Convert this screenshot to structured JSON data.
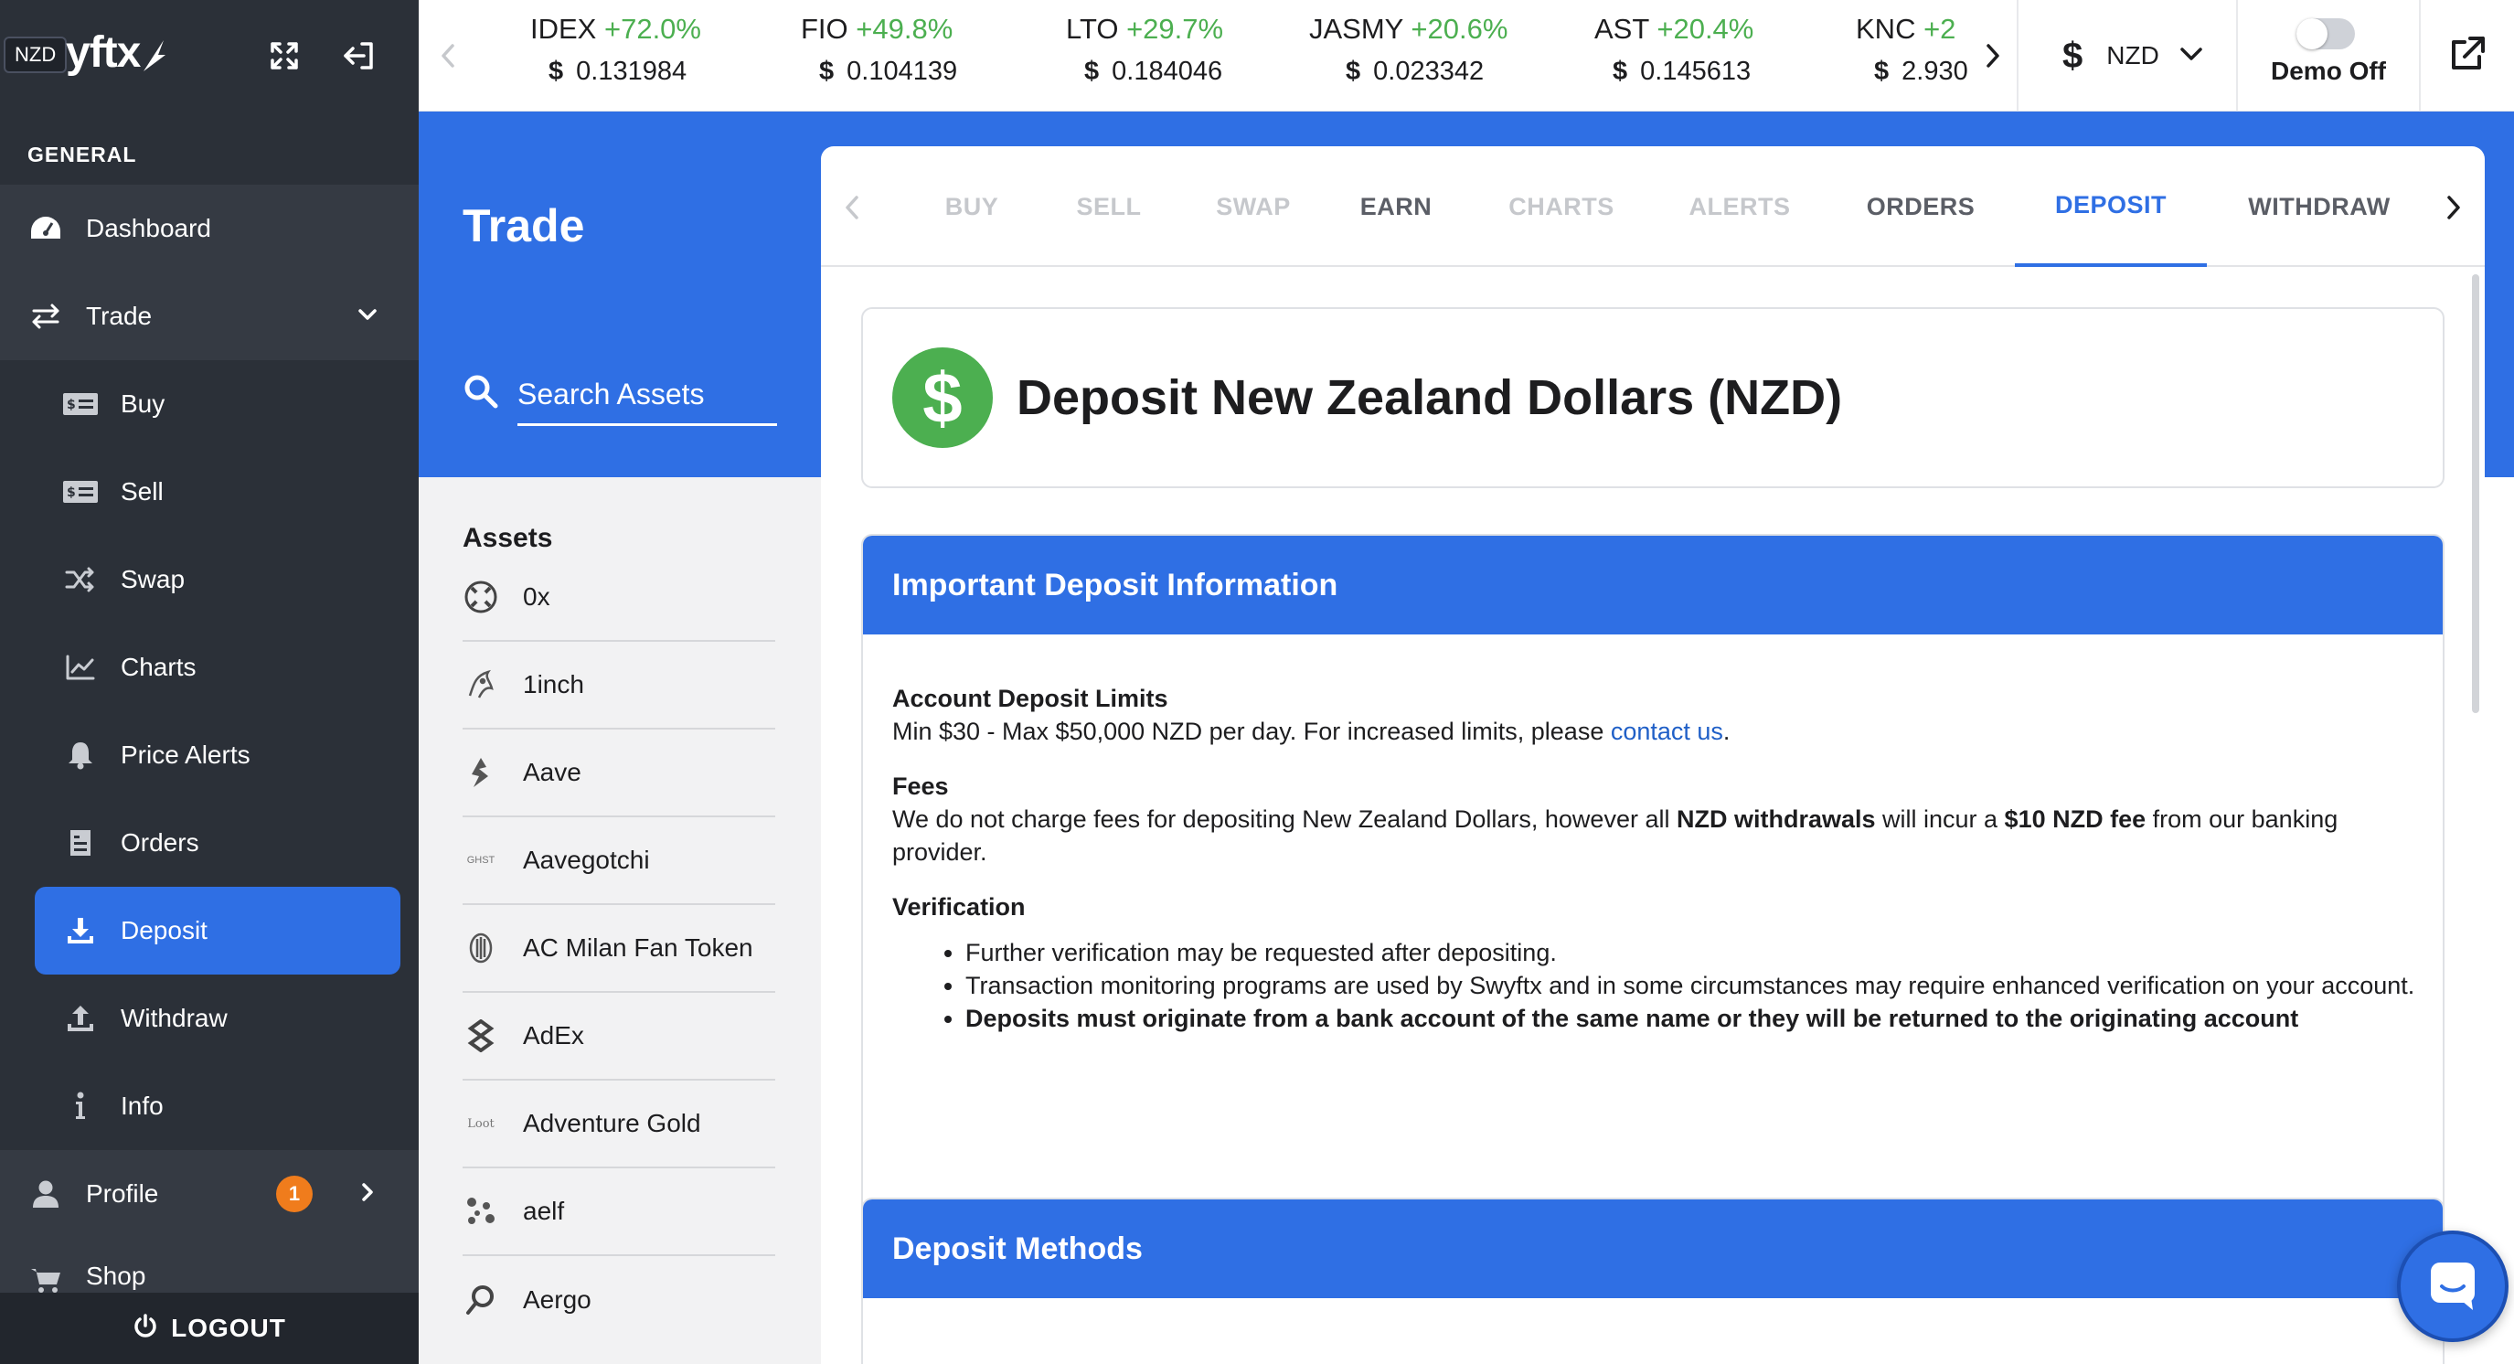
{
  "sidebar": {
    "currency_badge": "NZD",
    "logo": "yftx",
    "section_title": "GENERAL",
    "items": {
      "dashboard": "Dashboard",
      "trade": "Trade",
      "buy": "Buy",
      "sell": "Sell",
      "swap": "Swap",
      "charts": "Charts",
      "price_alerts": "Price Alerts",
      "orders": "Orders",
      "deposit": "Deposit",
      "withdraw": "Withdraw",
      "info": "Info",
      "profile": "Profile",
      "shop": "Shop"
    },
    "profile_badge": "1",
    "logout": "LOGOUT"
  },
  "ticker": {
    "items": [
      {
        "symbol": "IDEX",
        "change": "+72.0%",
        "currency": "$",
        "price": "0.131984"
      },
      {
        "symbol": "FIO",
        "change": "+49.8%",
        "currency": "$",
        "price": "0.104139"
      },
      {
        "symbol": "LTO",
        "change": "+29.7%",
        "currency": "$",
        "price": "0.184046"
      },
      {
        "symbol": "JASMY",
        "change": "+20.6%",
        "currency": "$",
        "price": "0.023342"
      },
      {
        "symbol": "AST",
        "change": "+20.4%",
        "currency": "$",
        "price": "0.145613"
      },
      {
        "symbol": "KNC",
        "change": "+2",
        "currency": "$",
        "price": "2.930"
      }
    ],
    "currency_symbol": "$",
    "currency_code": "NZD",
    "demo_label": "Demo Off"
  },
  "page": {
    "title": "Trade",
    "search_placeholder": "Search Assets",
    "assets_title": "Assets",
    "assets": [
      "0x",
      "1inch",
      "Aave",
      "Aavegotchi",
      "AC Milan Fan Token",
      "AdEx",
      "Adventure Gold",
      "aelf",
      "Aergo"
    ],
    "asset_icon_text": {
      "aavegotchi": "GHST",
      "adventure_gold": "Loot"
    }
  },
  "tabs": [
    "BUY",
    "SELL",
    "SWAP",
    "EARN",
    "CHARTS",
    "ALERTS",
    "ORDERS",
    "DEPOSIT",
    "WITHDRAW"
  ],
  "deposit": {
    "coin_symbol": "$",
    "title": "Deposit New Zealand Dollars (NZD)",
    "info_title": "Important Deposit Information",
    "limits_heading": "Account Deposit Limits",
    "limits_text": "Min $30 - Max $50,000 NZD per day. For increased limits, please ",
    "limits_link": "contact us",
    "limits_end": ".",
    "fees_heading": "Fees",
    "fees_text_1": "We do not charge fees for depositing New Zealand Dollars, however all ",
    "fees_bold_1": "NZD withdrawals",
    "fees_text_2": " will incur a ",
    "fees_bold_2": "$10 NZD fee",
    "fees_text_3": " from our banking provider.",
    "verification_heading": "Verification",
    "verification_items": [
      "Further verification may be requested after depositing.",
      "Transaction monitoring programs are used by Swyftx and in some circumstances may require enhanced verification on your account.",
      "Deposits must originate from a bank account of the same name or they will be returned to the originating account"
    ],
    "methods_title": "Deposit Methods"
  },
  "colors": {
    "brand_blue": "#2f6fe4",
    "positive_green": "#4caf50",
    "sidebar_bg": "#2b3038",
    "badge_orange": "#f07c1c"
  }
}
